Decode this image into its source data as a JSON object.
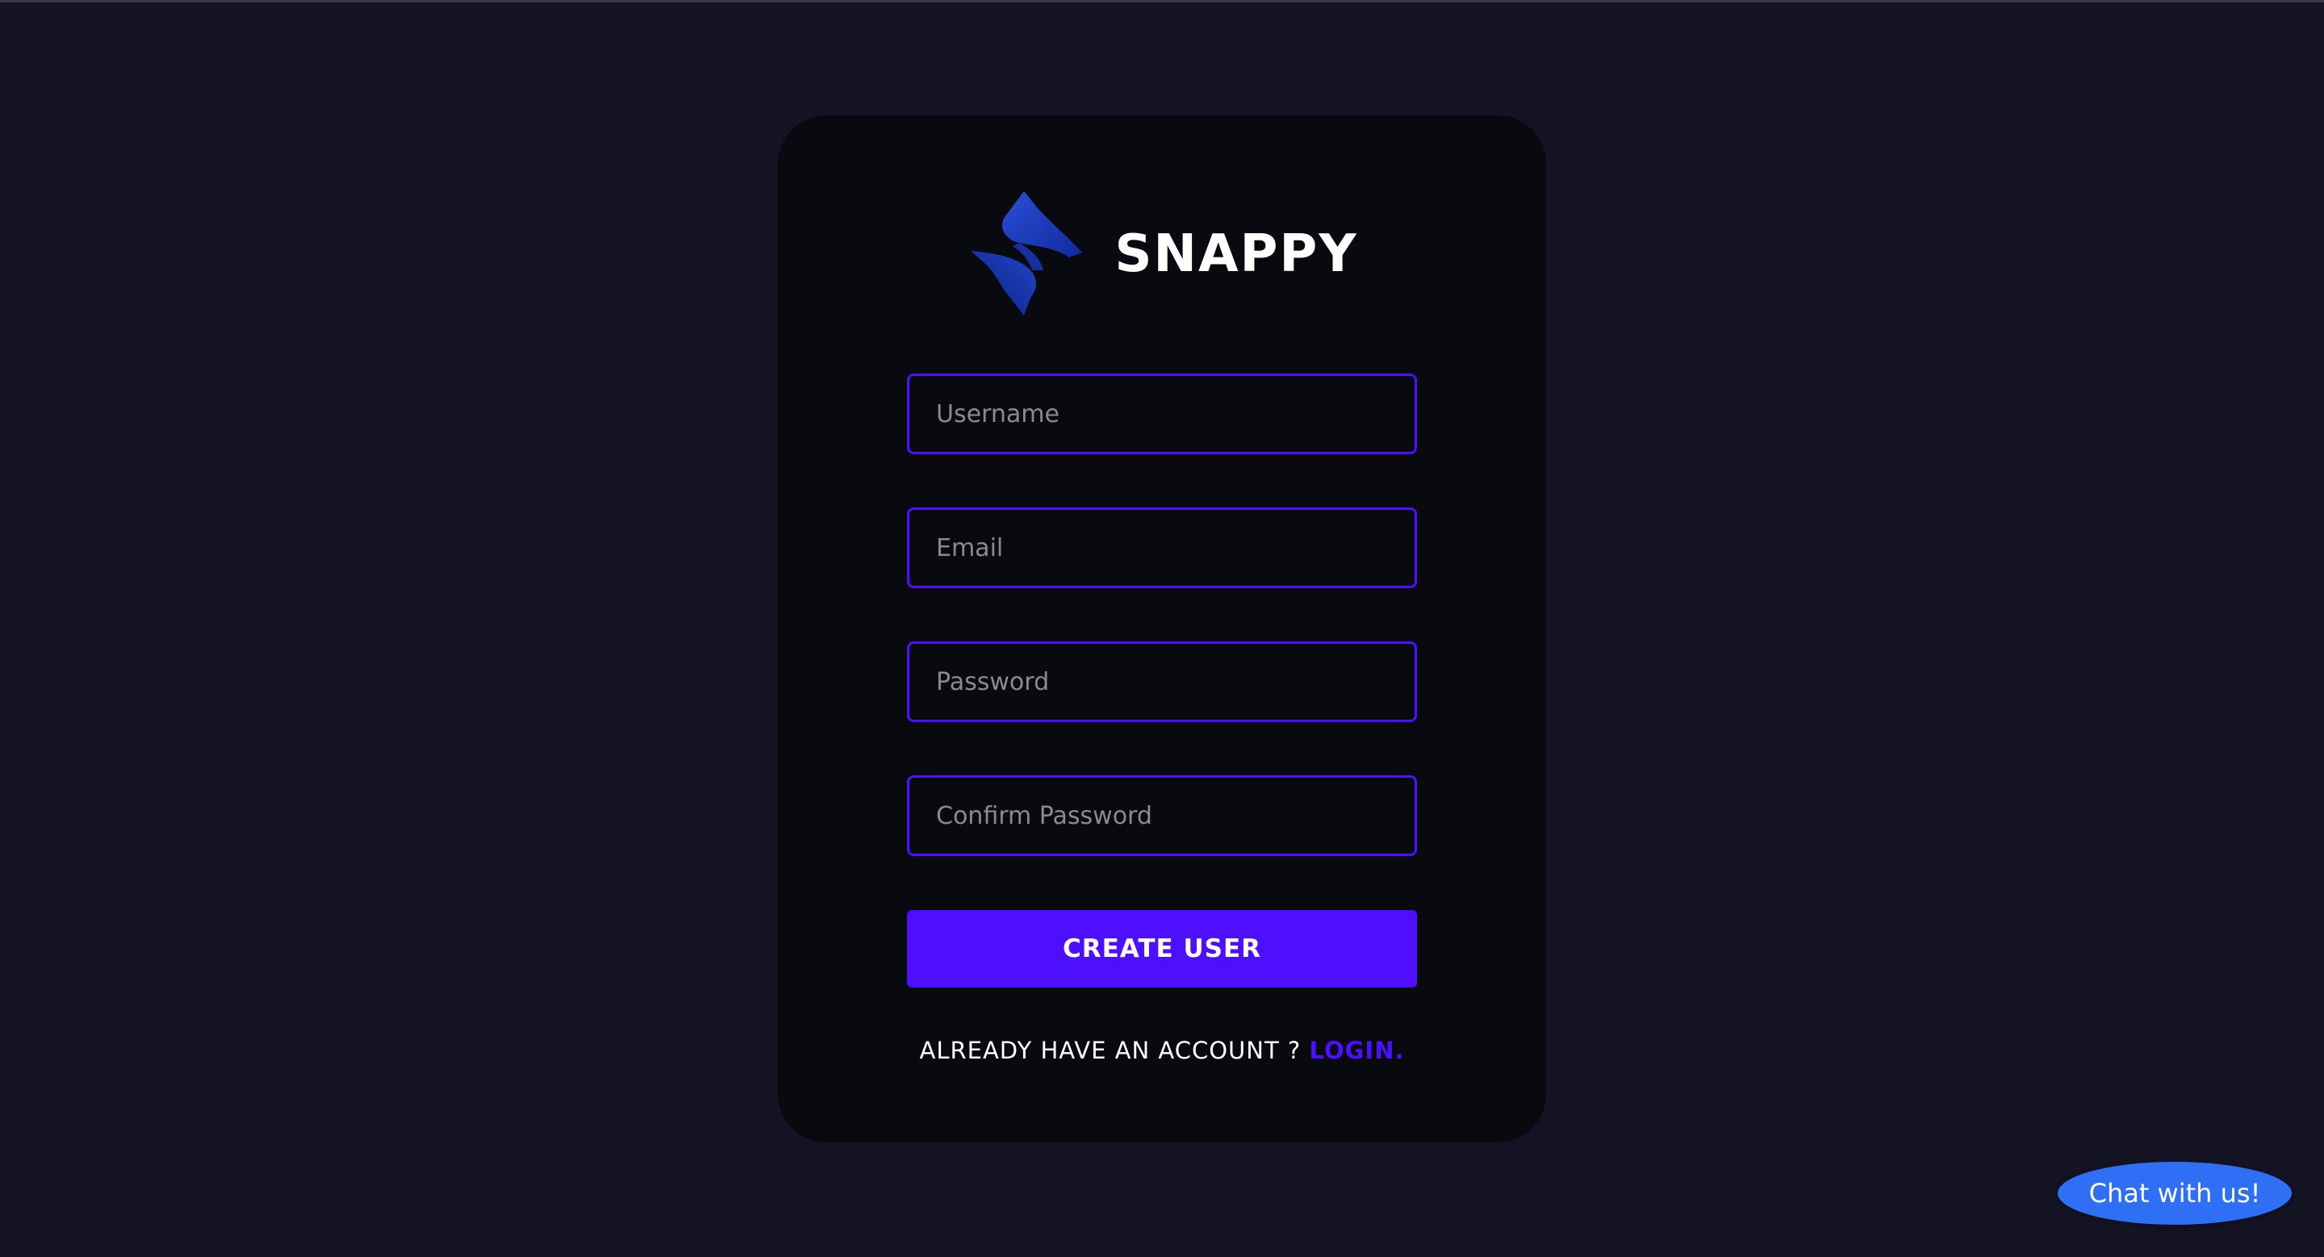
{
  "brand": {
    "name": "SNAPPY",
    "logo_icon": "snappy-logo-icon"
  },
  "form": {
    "username_placeholder": "Username",
    "email_placeholder": "Email",
    "password_placeholder": "Password",
    "confirm_password_placeholder": "Confirm Password",
    "submit_label": "CREATE USER"
  },
  "footer": {
    "prompt": "ALREADY HAVE AN ACCOUNT ?",
    "login_link": "LOGIN."
  },
  "chat": {
    "label": "Chat with us!"
  },
  "colors": {
    "page_background": "#131324",
    "card_background": "#090910",
    "accent": "#4e0eff",
    "chat_button": "#2f6ff5",
    "text": "#ffffff",
    "placeholder": "#8a8a8f"
  }
}
